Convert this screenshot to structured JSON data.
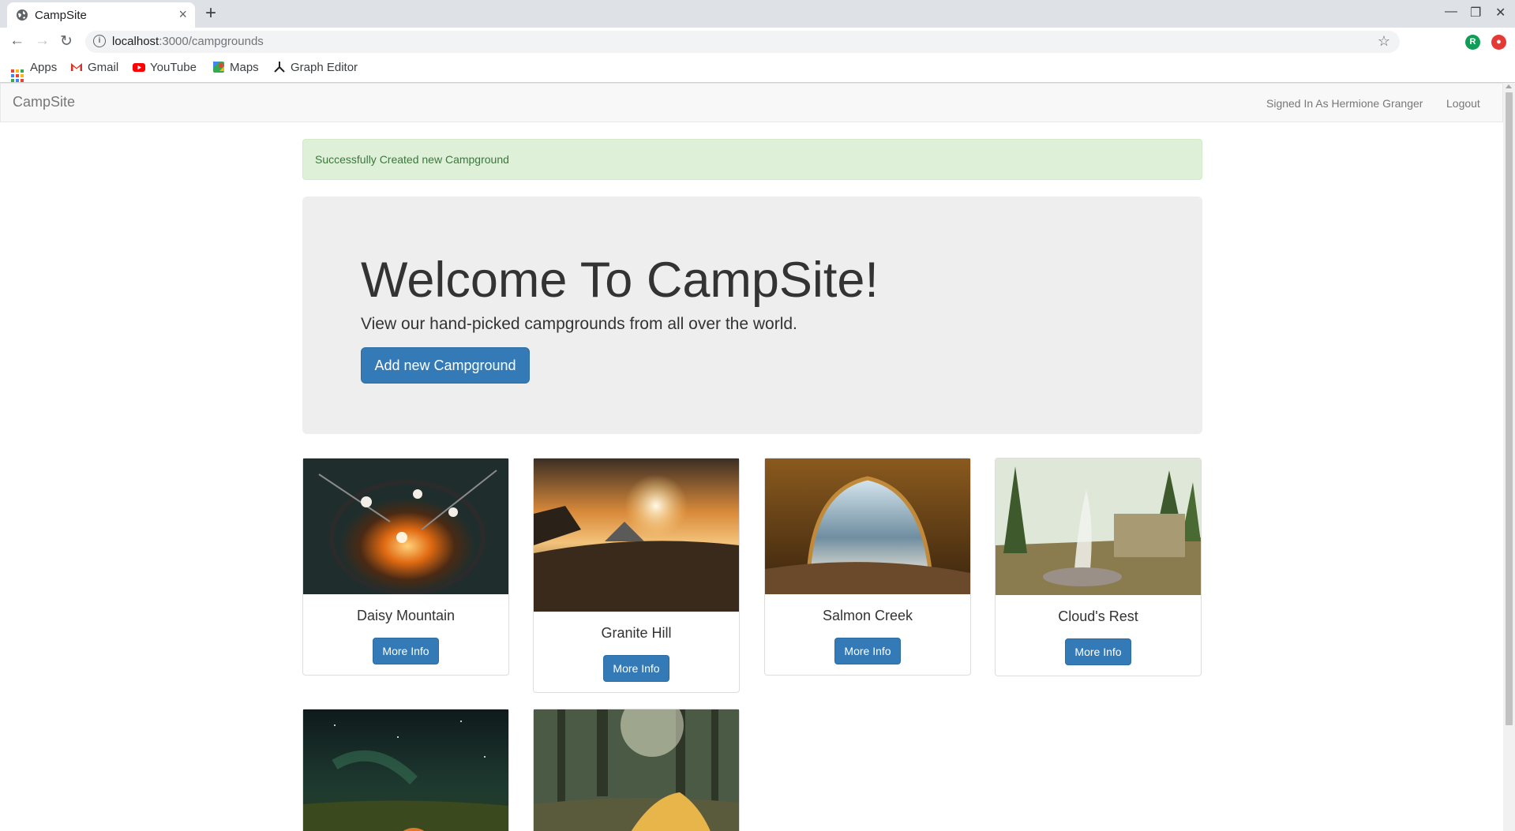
{
  "browser": {
    "tab_title": "CampSite",
    "tab_close": "×",
    "new_tab": "+",
    "url_host": "localhost",
    "url_path": ":3000/campgrounds",
    "profile_initial": "R",
    "bookmarks": [
      "Apps",
      "Gmail",
      "YouTube",
      "Maps",
      "Graph Editor"
    ]
  },
  "navbar": {
    "brand": "CampSite",
    "signed_in": "Signed In As Hermione Granger",
    "logout": "Logout"
  },
  "alert": {
    "message": "Successfully Created new Campground"
  },
  "jumbotron": {
    "heading": "Welcome To CampSite!",
    "lead": "View our hand-picked campgrounds from all over the world.",
    "button": "Add new Campground"
  },
  "campgrounds": [
    {
      "name": "Daisy Mountain",
      "button": "More Info"
    },
    {
      "name": "Granite Hill",
      "button": "More Info"
    },
    {
      "name": "Salmon Creek",
      "button": "More Info"
    },
    {
      "name": "Cloud's Rest",
      "button": "More Info"
    },
    {
      "name": "",
      "button": ""
    },
    {
      "name": "",
      "button": ""
    }
  ],
  "colors": {
    "primary": "#337ab7",
    "alert_bg": "#dff0d8",
    "alert_text": "#3c763d",
    "jumbotron_bg": "#eeeeee"
  }
}
